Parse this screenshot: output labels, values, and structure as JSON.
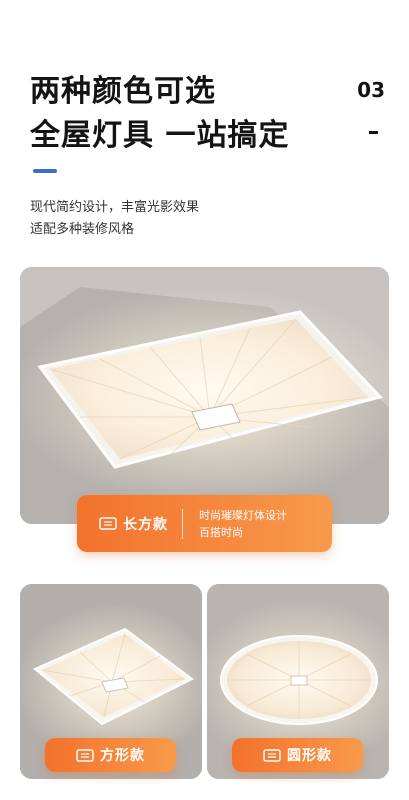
{
  "header": {
    "title_line1": "两种颜色可选",
    "title_line2": "全屋灯具 一站搞定",
    "page_number": "03"
  },
  "description": {
    "line1": "现代简约设计，丰富光影效果",
    "line2": "适配多种装修风格"
  },
  "products": {
    "rectangle": {
      "name": "长方款",
      "desc_line1": "时尚璀璨灯体设计",
      "desc_line2": "百搭时尚"
    },
    "square": {
      "name": "方形款"
    },
    "round": {
      "name": "圆形款"
    }
  },
  "colors": {
    "accent_orange": "#f3722c",
    "accent_blue": "#3e6dc4",
    "text_dark": "#141414"
  },
  "icons": [
    "lamp-icon"
  ]
}
